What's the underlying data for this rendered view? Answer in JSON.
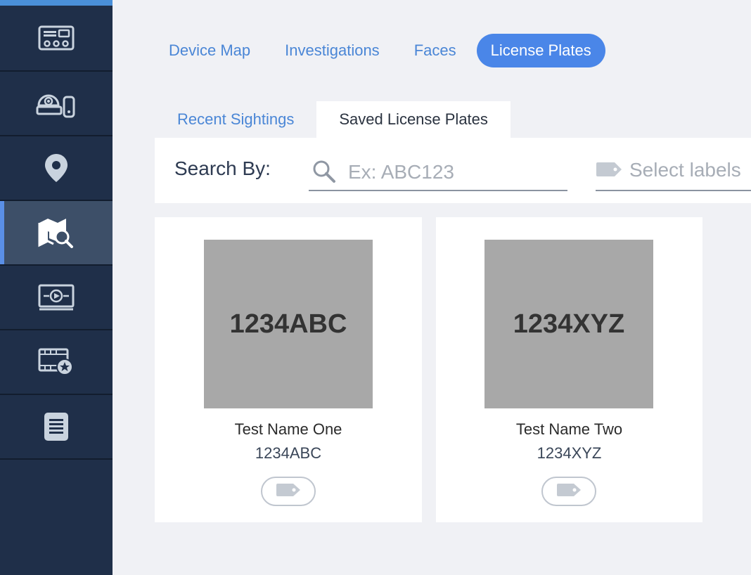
{
  "sidebar": {
    "items": [
      {
        "icon": "control-panel-icon",
        "active": false
      },
      {
        "icon": "camera-device-icon",
        "active": false
      },
      {
        "icon": "map-pin-icon",
        "active": false
      },
      {
        "icon": "map-search-icon",
        "active": true
      },
      {
        "icon": "monitor-play-icon",
        "active": false
      },
      {
        "icon": "film-star-icon",
        "active": false
      },
      {
        "icon": "document-icon",
        "active": false
      }
    ]
  },
  "tabs": [
    {
      "label": "Device Map",
      "active": false
    },
    {
      "label": "Investigations",
      "active": false
    },
    {
      "label": "Faces",
      "active": false
    },
    {
      "label": "License Plates",
      "active": true
    }
  ],
  "subtabs": [
    {
      "label": "Recent Sightings",
      "active": false
    },
    {
      "label": "Saved License Plates",
      "active": true
    }
  ],
  "search": {
    "label": "Search By:",
    "value": "",
    "placeholder": "Ex: ABC123",
    "labels_placeholder": "Select labels"
  },
  "plates": [
    {
      "image_text": "1234ABC",
      "name": "Test Name One",
      "plate": "1234ABC"
    },
    {
      "image_text": "1234XYZ",
      "name": "Test Name Two",
      "plate": "1234XYZ"
    }
  ],
  "colors": {
    "sidebar_bg": "#1f2f49",
    "accent": "#4a86e8",
    "page_bg": "#f0f1f5",
    "plate_placeholder": "#a8a8a8"
  }
}
